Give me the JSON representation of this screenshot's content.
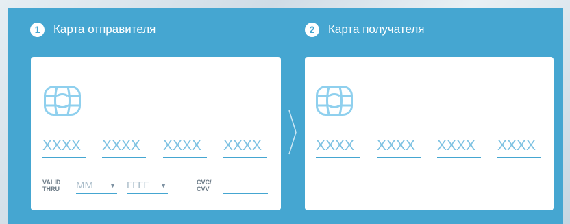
{
  "sender": {
    "step_number": "1",
    "title": "Карта отправителя",
    "card_number_placeholders": [
      "XXXX",
      "XXXX",
      "XXXX",
      "XXXX"
    ],
    "valid_thru_label": "VALID\nTHRU",
    "month_placeholder": "ММ",
    "year_placeholder": "ГГГГ",
    "cvc_label": "CVC/\nCVV",
    "cvc_value": ""
  },
  "recipient": {
    "step_number": "2",
    "title": "Карта получателя",
    "card_number_placeholders": [
      "XXXX",
      "XXXX",
      "XXXX",
      "XXXX"
    ]
  },
  "icons": {
    "chip": "card-chip-icon",
    "separator": "chevron-right-icon",
    "dropdown": "triangle-down-icon"
  },
  "colors": {
    "panel": "#45a6d1",
    "accent": "#45a6d1",
    "chip": "#8fd0ee",
    "card": "#ffffff"
  }
}
